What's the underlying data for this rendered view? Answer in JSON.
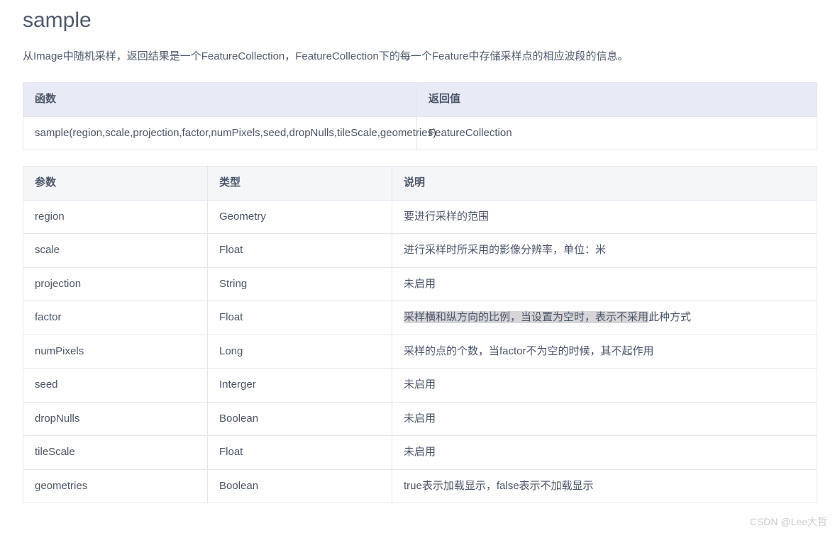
{
  "title": "sample",
  "description": "从Image中随机采样，返回结果是一个FeatureCollection，FeatureCollection下的每一个Feature中存储采样点的相应波段的信息。",
  "signature_table": {
    "headers": {
      "func": "函数",
      "ret": "返回值"
    },
    "func_signature": "sample(region,scale,projection,factor,numPixels,seed,dropNulls,tileScale,geometries)",
    "return_type": "FeatureCollection"
  },
  "params_table": {
    "headers": {
      "param": "参数",
      "type": "类型",
      "desc": "说明"
    },
    "rows": [
      {
        "param": "region",
        "type": "Geometry",
        "desc": "要进行采样的范围"
      },
      {
        "param": "scale",
        "type": "Float",
        "desc": "进行采样时所采用的影像分辨率，单位：米"
      },
      {
        "param": "projection",
        "type": "String",
        "desc": "未启用"
      },
      {
        "param": "factor",
        "type": "Float",
        "desc_hl": "采样横和纵方向的比例，当设置为空时，表示不采用",
        "desc_tail": "此种方式"
      },
      {
        "param": "numPixels",
        "type": "Long",
        "desc": "采样的点的个数，当factor不为空的时候，其不起作用"
      },
      {
        "param": "seed",
        "type": "Interger",
        "desc": "未启用"
      },
      {
        "param": "dropNulls",
        "type": "Boolean",
        "desc": "未启用"
      },
      {
        "param": "tileScale",
        "type": "Float",
        "desc": "未启用"
      },
      {
        "param": "geometries",
        "type": "Boolean",
        "desc": "true表示加载显示，false表示不加载显示"
      }
    ]
  },
  "watermark": "CSDN @Lee大哲"
}
